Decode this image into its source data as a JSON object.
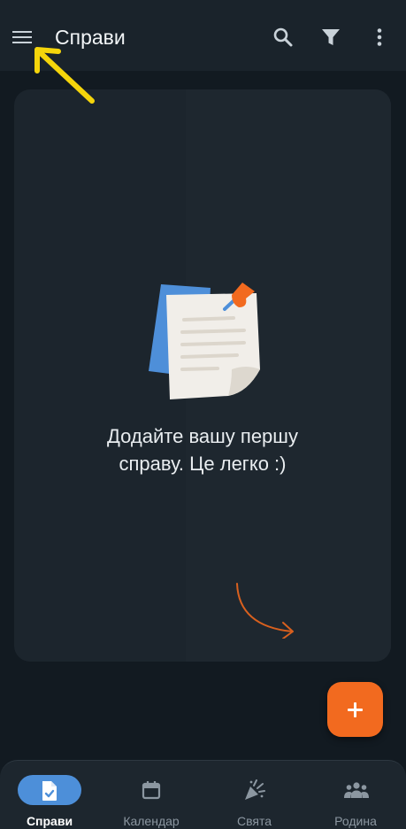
{
  "app_bar": {
    "title": "Справи",
    "menu_icon": "hamburger-menu-icon",
    "search_icon": "search-icon",
    "filter_icon": "filter-icon",
    "more_icon": "more-vertical-icon"
  },
  "empty_state": {
    "message_line1": "Додайте вашу першу",
    "message_line2": "справу. Це легко :)",
    "illustration": "pinned-note-illustration",
    "pointer": "curved-arrow-icon"
  },
  "fab": {
    "icon": "plus-icon"
  },
  "bottom_nav": {
    "items": [
      {
        "label": "Справи",
        "icon": "task-document-icon",
        "active": true
      },
      {
        "label": "Календар",
        "icon": "calendar-icon",
        "active": false
      },
      {
        "label": "Свята",
        "icon": "party-popper-icon",
        "active": false
      },
      {
        "label": "Родина",
        "icon": "family-group-icon",
        "active": false
      }
    ]
  },
  "colors": {
    "background": "#121a21",
    "card": "#1c252d",
    "accent_orange": "#f26a1f",
    "active_pill": "#4d8fd9",
    "annotation_arrow": "#f5d50b"
  }
}
